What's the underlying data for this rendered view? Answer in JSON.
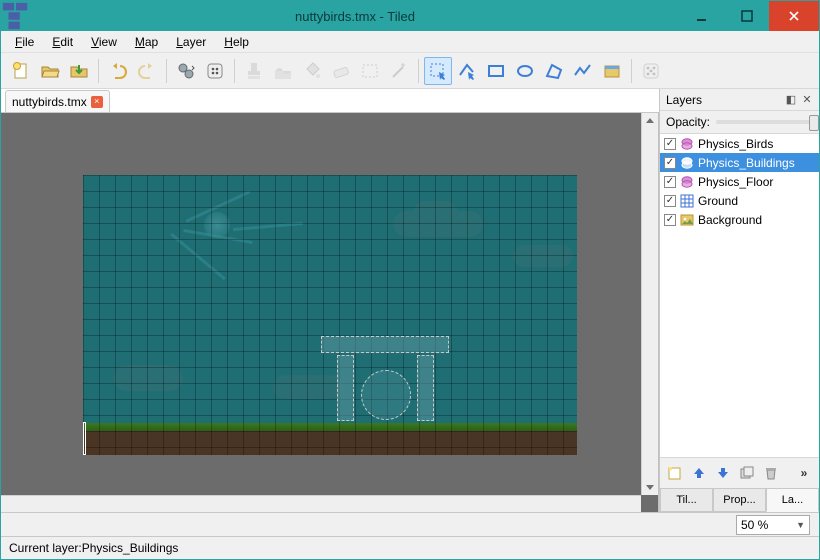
{
  "window": {
    "title": "nuttybirds.tmx - Tiled"
  },
  "menu": {
    "file": "File",
    "edit": "Edit",
    "view": "View",
    "map": "Map",
    "layer": "Layer",
    "help": "Help"
  },
  "tab": {
    "name": "nuttybirds.tmx"
  },
  "panel": {
    "layers_title": "Layers",
    "opacity_label": "Opacity:"
  },
  "layers": [
    {
      "name": "Physics_Birds",
      "type": "object",
      "checked": true,
      "selected": false
    },
    {
      "name": "Physics_Buildings",
      "type": "object",
      "checked": true,
      "selected": true
    },
    {
      "name": "Physics_Floor",
      "type": "object",
      "checked": true,
      "selected": false
    },
    {
      "name": "Ground",
      "type": "tile",
      "checked": true,
      "selected": false
    },
    {
      "name": "Background",
      "type": "image",
      "checked": true,
      "selected": false
    }
  ],
  "right_tabs": {
    "tilesets": "Til...",
    "properties": "Prop...",
    "layers": "La..."
  },
  "zoom": {
    "value": "50 %"
  },
  "status": {
    "current_layer_label": "Current layer: ",
    "current_layer": "Physics_Buildings"
  }
}
